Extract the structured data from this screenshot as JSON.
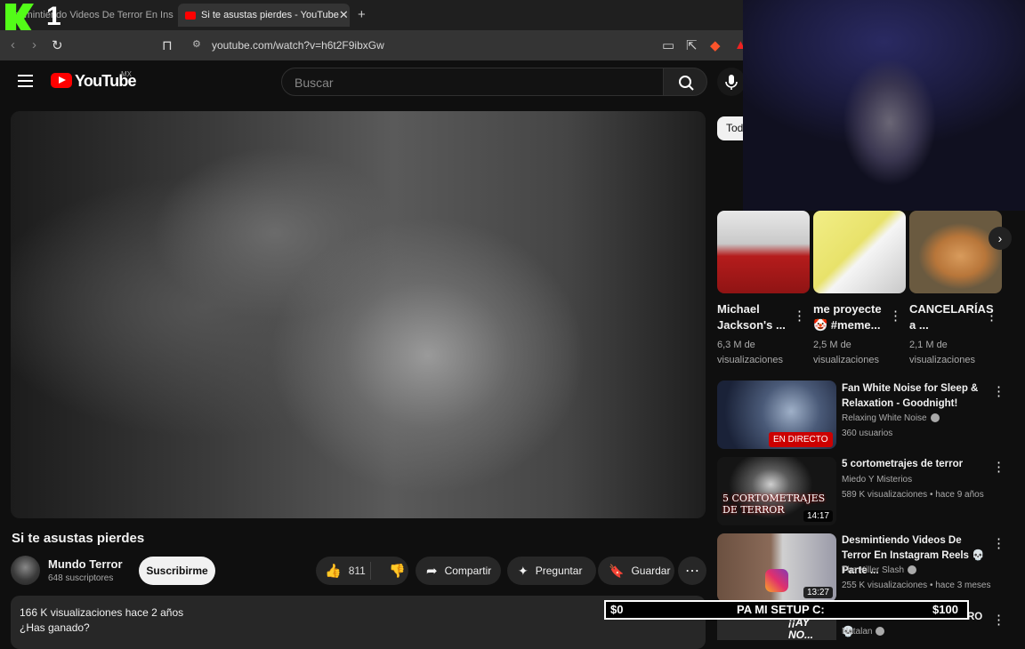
{
  "browser": {
    "tabs": [
      {
        "title": "Desmintiendo Videos De Terror En Ins",
        "active": false
      },
      {
        "title": "Si te asustas pierdes - YouTube",
        "active": true
      }
    ],
    "url": "youtube.com/watch?v=h6t2F9ibxGw",
    "overlay_number": "1"
  },
  "youtube": {
    "brand": "YouTube",
    "country": "MX",
    "search_placeholder": "Buscar"
  },
  "video": {
    "title": "Si te asustas pierdes",
    "channel": "Mundo Terror",
    "subscribers": "648 suscriptores",
    "subscribe_label": "Suscribirme",
    "likes": "811",
    "share_label": "Compartir",
    "ask_label": "Preguntar",
    "save_label": "Guardar",
    "views": "166 K visualizaciones  hace 2 años",
    "description": "¿Has ganado?"
  },
  "donation_bar": {
    "left": "$0",
    "label": "PA MI SETUP C:",
    "right": "$100",
    "progress": 0.0
  },
  "sidebar": {
    "chip": "Todos",
    "shorts": [
      {
        "title": "Michael Jackson's ...",
        "views": "6,3 M de visualizaciones"
      },
      {
        "title": "me proyecte 🤡 #meme...",
        "views": "2,5 M de visualizaciones"
      },
      {
        "title": "CANCELARÍAS a ...",
        "views": "2,1 M de visualizaciones"
      }
    ],
    "videos": [
      {
        "title": "Fan White Noise for Sleep & Relaxation - Goodnight!",
        "channel": "Relaxing White Noise",
        "meta": "360 usuarios",
        "badge": "EN DIRECTO",
        "thumb_text": ""
      },
      {
        "title": "5 cortometrajes de terror",
        "channel": "Miedo Y Misterios",
        "meta": "589 K visualizaciones • hace 9 años",
        "duration": "14:17",
        "thumb_text": "5 CORTOMETRAJES DE TERROR"
      },
      {
        "title": "Desmintiendo Videos De Terror En Instagram Reels 💀 Parte ...",
        "channel": "The Killer Slash",
        "meta": "255 K visualizaciones • hace 3 meses",
        "duration": "13:27",
        "thumb_text": ""
      },
      {
        "title": "ESA COSA NO ES MI PERRO 💀",
        "channel": "Natalan",
        "meta": "",
        "thumb_text": "¡¡AY NO..."
      }
    ]
  },
  "colors": {
    "brand_red": "#ff0000",
    "kick_green": "#53fc18",
    "background": "#0f0f0f"
  }
}
